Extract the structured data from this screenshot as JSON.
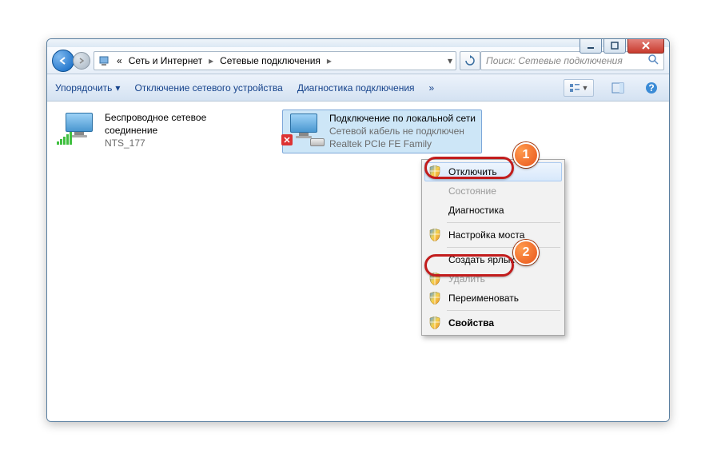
{
  "breadcrumb": {
    "prefix": "«",
    "seg1": "Сеть и Интернет",
    "seg2": "Сетевые подключения"
  },
  "search": {
    "placeholder": "Поиск: Сетевые подключения"
  },
  "toolbar": {
    "organize": "Упорядочить",
    "disable_device": "Отключение сетевого устройства",
    "diagnose": "Диагностика подключения"
  },
  "connections": [
    {
      "title": "Беспроводное сетевое соединение",
      "status": "",
      "device": "NTS_177"
    },
    {
      "title": "Подключение по локальной сети",
      "status": "Сетевой кабель не подключен",
      "device": "Realtek PCIe FE Family"
    }
  ],
  "context_menu": {
    "items": [
      {
        "label": "Отключить",
        "shield": true,
        "state": "hover"
      },
      {
        "label": "Состояние",
        "shield": false,
        "state": "disabled"
      },
      {
        "label": "Диагностика",
        "shield": false,
        "state": ""
      },
      {
        "sep": true
      },
      {
        "label": "Настройка моста",
        "shield": true,
        "state": ""
      },
      {
        "sep": true
      },
      {
        "label": "Создать ярлык",
        "shield": false,
        "state": ""
      },
      {
        "label": "Удалить",
        "shield": true,
        "state": "disabled"
      },
      {
        "label": "Переименовать",
        "shield": true,
        "state": ""
      },
      {
        "sep": true
      },
      {
        "label": "Свойства",
        "shield": true,
        "state": "",
        "bold": true
      }
    ]
  },
  "callouts": {
    "c1": "1",
    "c2": "2"
  }
}
